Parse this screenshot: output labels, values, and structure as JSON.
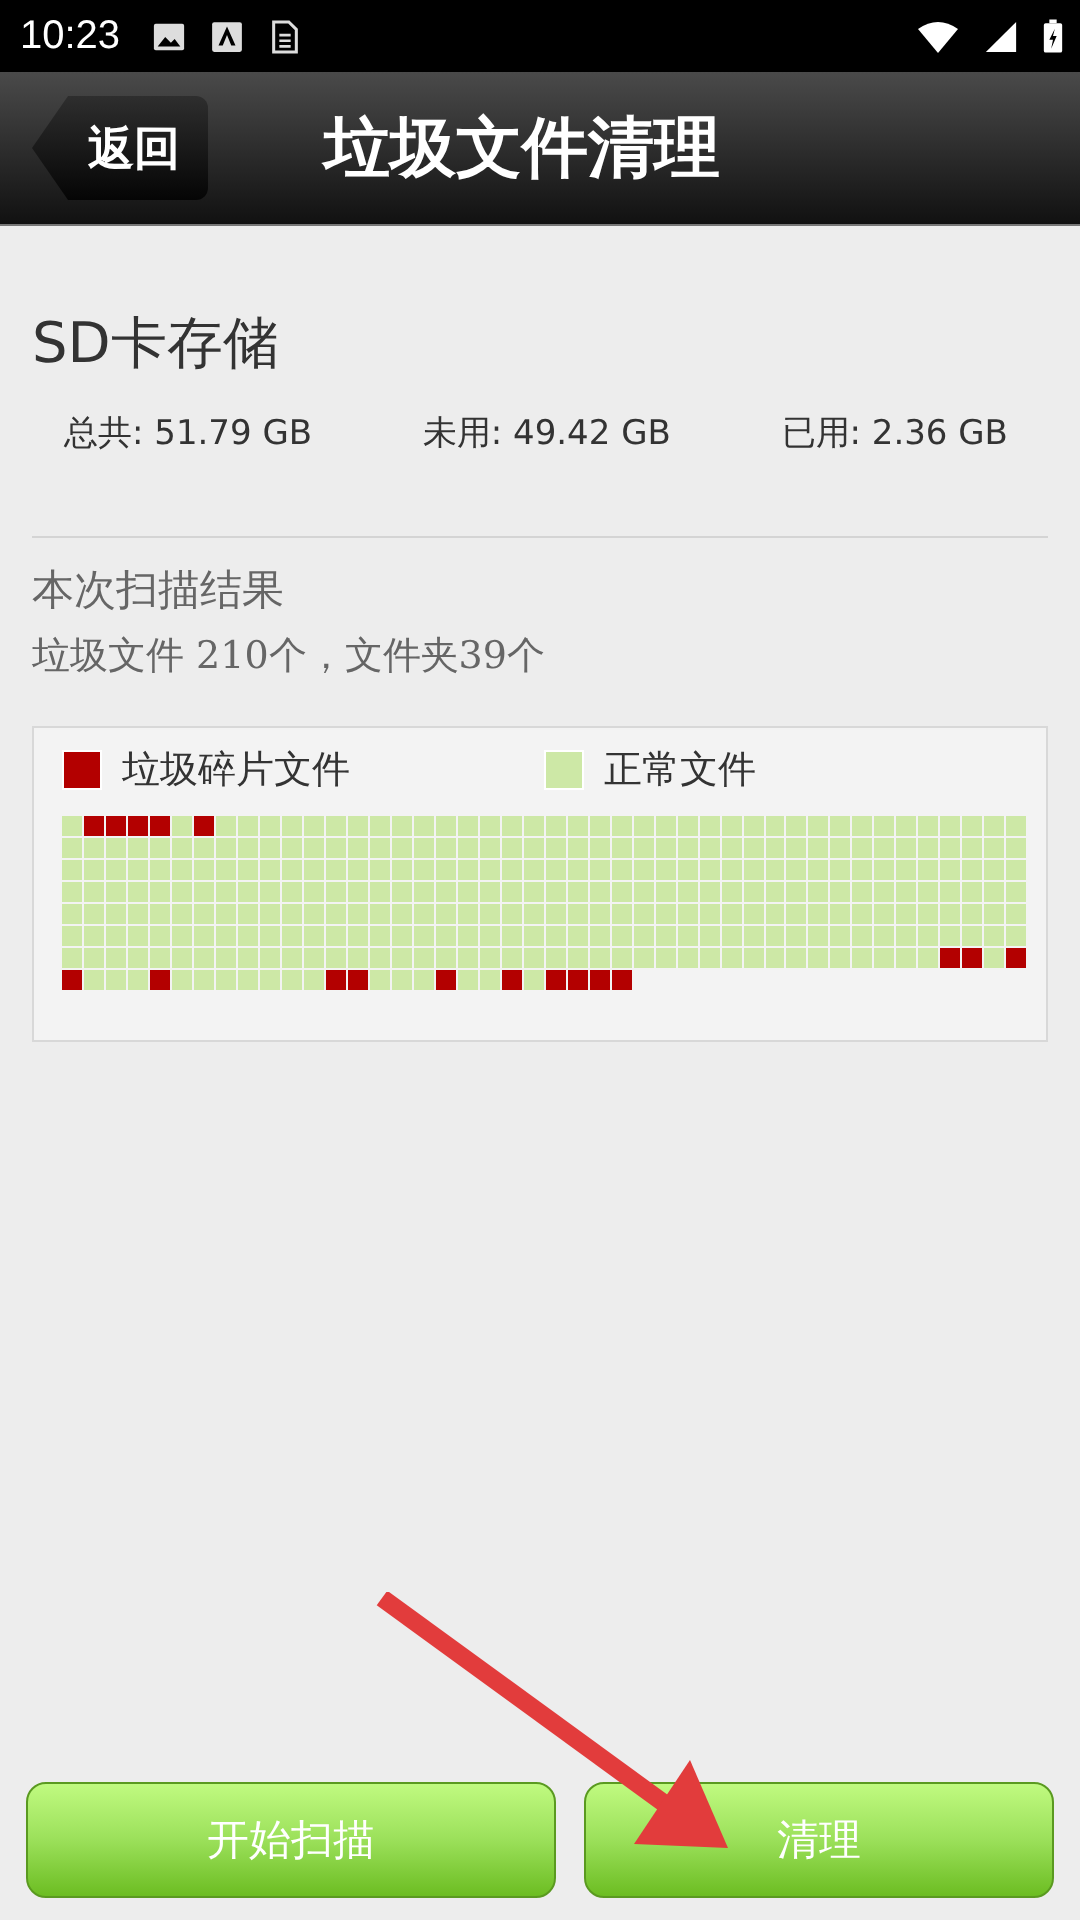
{
  "status_bar": {
    "time": "10:23"
  },
  "header": {
    "back": "返回",
    "title": "垃圾文件清理"
  },
  "storage": {
    "title": "SD卡存储",
    "stats": [
      {
        "label": "总共:",
        "value": "51.79 GB"
      },
      {
        "label": "未用:",
        "value": "49.42 GB"
      },
      {
        "label": "已用:",
        "value": "2.36 GB"
      }
    ]
  },
  "scan": {
    "title": "本次扫描结果",
    "summary": "垃圾文件 210个，文件夹39个"
  },
  "legend": [
    {
      "label": "垃圾碎片文件",
      "color": "#b30000"
    },
    {
      "label": "正常文件",
      "color": "#cde8a6"
    }
  ],
  "junk_rows": [
    [
      false,
      true,
      true,
      true,
      true,
      false,
      true,
      false,
      false,
      false,
      false,
      false,
      false,
      false,
      false,
      false,
      false,
      false,
      false,
      false,
      false,
      false,
      false,
      false,
      false,
      false,
      false,
      false,
      false,
      false,
      false,
      false,
      false,
      false,
      false,
      false,
      false,
      false,
      false,
      false,
      false,
      false,
      false,
      false
    ],
    [
      false,
      false,
      false,
      false,
      false,
      false,
      false,
      false,
      false,
      false,
      false,
      false,
      false,
      false,
      false,
      false,
      false,
      false,
      false,
      false,
      false,
      false,
      false,
      false,
      false,
      false,
      false,
      false,
      false,
      false,
      false,
      false,
      false,
      false,
      false,
      false,
      false,
      false,
      false,
      false,
      false,
      false,
      false,
      false
    ],
    [
      false,
      false,
      false,
      false,
      false,
      false,
      false,
      false,
      false,
      false,
      false,
      false,
      false,
      false,
      false,
      false,
      false,
      false,
      false,
      false,
      false,
      false,
      false,
      false,
      false,
      false,
      false,
      false,
      false,
      false,
      false,
      false,
      false,
      false,
      false,
      false,
      false,
      false,
      false,
      false,
      false,
      false,
      false,
      false
    ],
    [
      false,
      false,
      false,
      false,
      false,
      false,
      false,
      false,
      false,
      false,
      false,
      false,
      false,
      false,
      false,
      false,
      false,
      false,
      false,
      false,
      false,
      false,
      false,
      false,
      false,
      false,
      false,
      false,
      false,
      false,
      false,
      false,
      false,
      false,
      false,
      false,
      false,
      false,
      false,
      false,
      false,
      false,
      false,
      false
    ],
    [
      false,
      false,
      false,
      false,
      false,
      false,
      false,
      false,
      false,
      false,
      false,
      false,
      false,
      false,
      false,
      false,
      false,
      false,
      false,
      false,
      false,
      false,
      false,
      false,
      false,
      false,
      false,
      false,
      false,
      false,
      false,
      false,
      false,
      false,
      false,
      false,
      false,
      false,
      false,
      false,
      false,
      false,
      false,
      false
    ],
    [
      false,
      false,
      false,
      false,
      false,
      false,
      false,
      false,
      false,
      false,
      false,
      false,
      false,
      false,
      false,
      false,
      false,
      false,
      false,
      false,
      false,
      false,
      false,
      false,
      false,
      false,
      false,
      false,
      false,
      false,
      false,
      false,
      false,
      false,
      false,
      false,
      false,
      false,
      false,
      false,
      false,
      false,
      false,
      false
    ],
    [
      false,
      false,
      false,
      false,
      false,
      false,
      false,
      false,
      false,
      false,
      false,
      false,
      false,
      false,
      false,
      false,
      false,
      false,
      false,
      false,
      false,
      false,
      false,
      false,
      false,
      false,
      false,
      false,
      false,
      false,
      false,
      false,
      false,
      false,
      false,
      false,
      false,
      false,
      false,
      false,
      true,
      true,
      false,
      true
    ],
    [
      true,
      false,
      false,
      false,
      true,
      false,
      false,
      false,
      false,
      false,
      false,
      false,
      true,
      true,
      false,
      false,
      false,
      true,
      false,
      false,
      true,
      false,
      true,
      true,
      true,
      true
    ]
  ],
  "buttons": [
    {
      "label": "开始扫描"
    },
    {
      "label": "清理"
    }
  ]
}
